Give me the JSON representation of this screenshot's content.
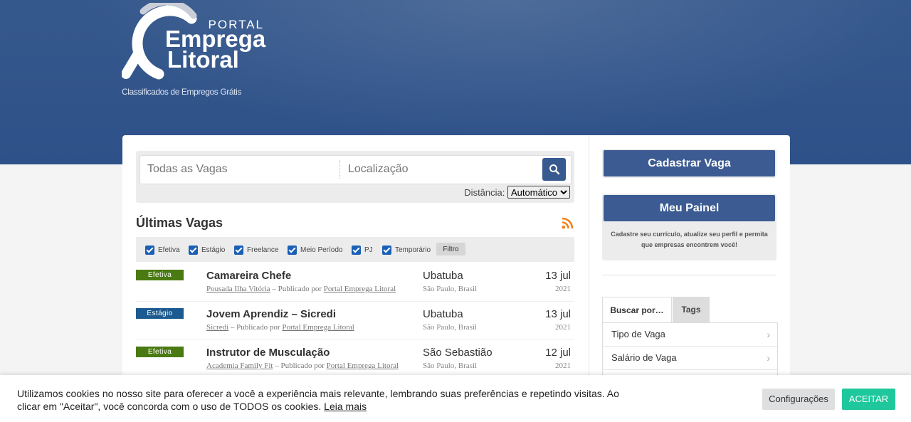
{
  "header": {
    "logo": {
      "line1": "PORTAL",
      "line2": "Emprega",
      "line3": "Litoral"
    },
    "tagline": "Classificados de Empregos Grátis"
  },
  "search": {
    "keywords_placeholder": "Todas as Vagas",
    "location_placeholder": "Localização",
    "distance_label": "Distância:",
    "distance_value": "Automático"
  },
  "listing": {
    "title": "Últimas Vagas",
    "filters": [
      {
        "label": "Efetiva",
        "checked": true
      },
      {
        "label": "Estágio",
        "checked": true
      },
      {
        "label": "Freelance",
        "checked": true
      },
      {
        "label": "Meio Período",
        "checked": true
      },
      {
        "label": "PJ",
        "checked": true
      },
      {
        "label": "Temporário",
        "checked": true
      }
    ],
    "filter_button": "Filtro",
    "jobs": [
      {
        "type": "Efetiva",
        "type_color": "#4a7a12",
        "title": "Camareira Chefe",
        "company": "Pousada Ilha Vitória",
        "posted_by_text": " – Publicado por ",
        "poster": "Portal Emprega Litoral",
        "city": "Ubatuba",
        "region": "São Paulo, Brasil",
        "date": "13 jul",
        "year": "2021"
      },
      {
        "type": "Estágio",
        "type_color": "#1b5a90",
        "title": "Jovem Aprendiz – Sicredi",
        "company": "Sicredi",
        "posted_by_text": " – Publicado por ",
        "poster": "Portal Emprega Litoral",
        "city": "Ubatuba",
        "region": "São Paulo, Brasil",
        "date": "13 jul",
        "year": "2021"
      },
      {
        "type": "Efetiva",
        "type_color": "#4a7a12",
        "title": "Instrutor de Musculação",
        "company": "Academia Family Fit",
        "posted_by_text": " – Publicado por ",
        "poster": "Portal Emprega Litoral",
        "city": "São Sebastião",
        "region": "São Paulo, Brasil",
        "date": "12 jul",
        "year": "2021"
      }
    ]
  },
  "sidebar": {
    "post_job_button": "Cadastrar Vaga",
    "dashboard_button": "Meu Painel",
    "dashboard_note": "Cadastre seu currículo, atualize seu perfil e permita que empresas encontrem você!",
    "tabs": [
      "Buscar por…",
      "Tags"
    ],
    "browse_items": [
      "Tipo de Vaga",
      "Salário de Vaga"
    ]
  },
  "cookie": {
    "text": "Utilizamos cookies no nosso site para oferecer a você a experiência mais relevante, lembrando suas preferências e repetindo visitas. Ao clicar em \"Aceitar\", você concorda com o uso de TODOS os cookies.",
    "read_more": "Leia mais",
    "settings_button": "Configurações",
    "accept_button": "ACEITAR"
  },
  "colors": {
    "header_blue": "#2e5189",
    "button_blue": "#3b5b92",
    "accept_green": "#1ec89c",
    "rss_orange": "#f0811c"
  },
  "icons": {
    "search": "search-icon",
    "rss": "rss-icon",
    "chevron": "chevron-right-icon"
  }
}
